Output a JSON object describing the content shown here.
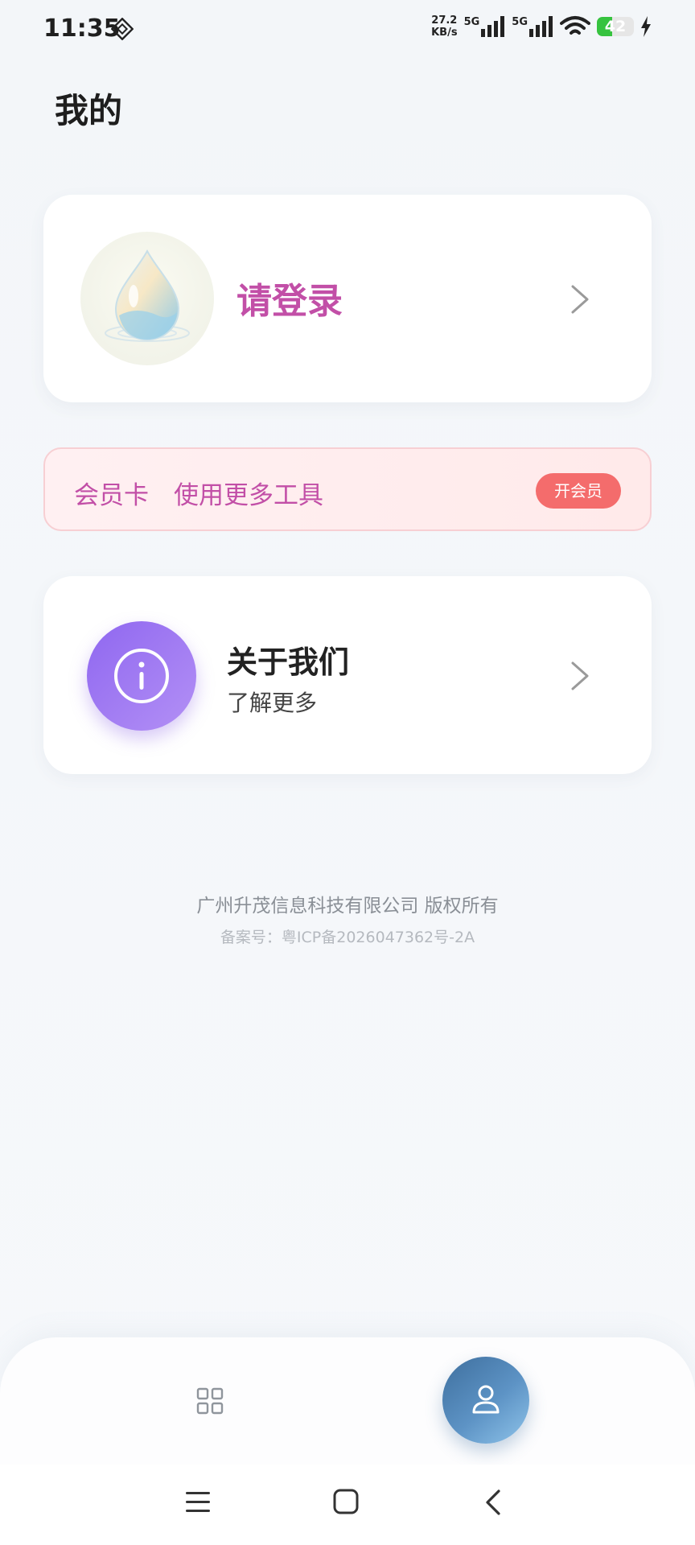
{
  "status_bar": {
    "time": "11:35",
    "net_speed_value": "27.2",
    "net_speed_unit": "KB/s",
    "sim1_label": "5G",
    "sim2_label": "5G",
    "battery_level": "42",
    "battery_fraction": 0.42
  },
  "page": {
    "title": "我的"
  },
  "login_card": {
    "prompt": "请登录"
  },
  "vip_card": {
    "title": "会员卡",
    "subtitle": "使用更多工具",
    "button_label": "开会员"
  },
  "about_card": {
    "title": "关于我们",
    "subtitle": "了解更多"
  },
  "footer": {
    "copyright": "广州升茂信息科技有限公司 版权所有",
    "icp": "备案号：粤ICP备2026047362号-2A"
  },
  "tab_bar": {
    "tabs": [
      {
        "icon": "grid-icon",
        "active": false
      },
      {
        "icon": "person-icon",
        "active": true
      }
    ]
  },
  "colors": {
    "accent_pink": "#c24fa7",
    "vip_button": "#f46c6c",
    "about_icon": "#8f67f0",
    "active_tab": "#4f86bb",
    "battery": "#36c33f"
  }
}
